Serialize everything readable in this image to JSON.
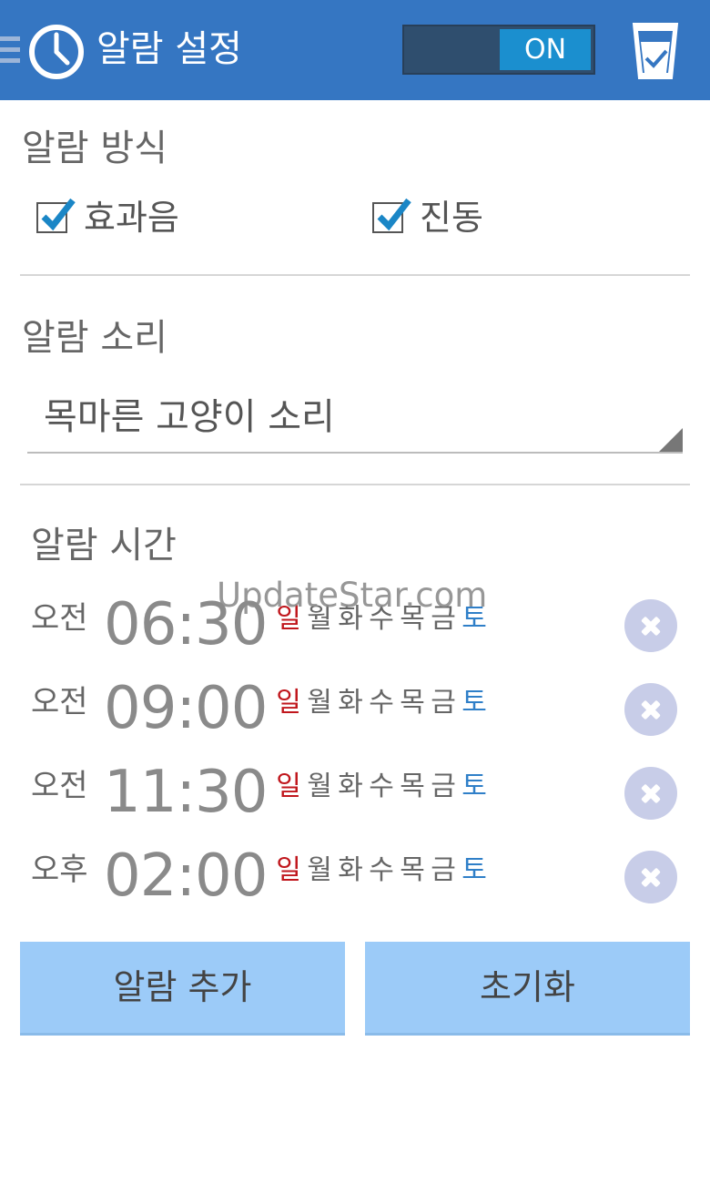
{
  "header": {
    "title": "알람 설정",
    "toggle_label": "ON",
    "icons": [
      "menu-icon",
      "clock-icon",
      "cup-icon"
    ]
  },
  "alarm_method": {
    "title": "알람 방식",
    "options": [
      {
        "label": "효과음",
        "checked": true
      },
      {
        "label": "진동",
        "checked": true
      }
    ]
  },
  "alarm_sound": {
    "title": "알람 소리",
    "selected": "목마른 고양이 소리"
  },
  "alarm_time": {
    "title": "알람 시간",
    "alarms": [
      {
        "ampm": "오전",
        "time": "06:30",
        "days": [
          "일",
          "월",
          "화",
          "수",
          "목",
          "금",
          "토"
        ]
      },
      {
        "ampm": "오전",
        "time": "09:00",
        "days": [
          "일",
          "월",
          "화",
          "수",
          "목",
          "금",
          "토"
        ]
      },
      {
        "ampm": "오전",
        "time": "11:30",
        "days": [
          "일",
          "월",
          "화",
          "수",
          "목",
          "금",
          "토"
        ]
      },
      {
        "ampm": "오후",
        "time": "02:00",
        "days": [
          "일",
          "월",
          "화",
          "수",
          "목",
          "금",
          "토"
        ]
      }
    ]
  },
  "watermark": "UpdateStar.com",
  "buttons": {
    "add": "알람 추가",
    "reset": "초기화"
  },
  "colors": {
    "header": "#3576c2",
    "sunday": "#c0161c",
    "saturday": "#2f7fc8",
    "button": "#9ccbf8"
  }
}
